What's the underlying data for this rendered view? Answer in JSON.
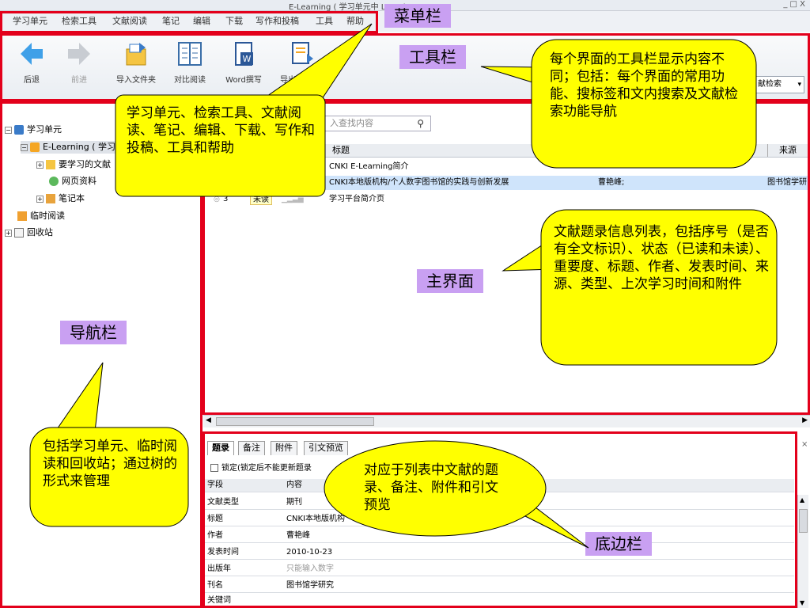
{
  "window": {
    "title": "E-Learning ( 学习单元中 Learning",
    "controls": "_  □  X"
  },
  "menu": [
    "学习单元",
    "检索工具",
    "文献阅读",
    "笔记",
    "编辑",
    "下载",
    "写作和投稿",
    "工具",
    "帮助"
  ],
  "toolbar": {
    "back": "后退",
    "forward": "前进",
    "import_folder": "导入文件夹",
    "compare_read": "对比阅读",
    "word_write": "Word撰写",
    "export_word": "导出到Word",
    "search_combo": "献检索"
  },
  "nav": {
    "root": "学习单元",
    "elearning": "E-Learning ( 学习",
    "to_learn": "要学习的文献",
    "web": "网页资料",
    "notebook": "笔记本",
    "temp_read": "临时阅读",
    "recycle": "回收站"
  },
  "main": {
    "search_placeholder": "入查找内容",
    "columns": {
      "title": "标题",
      "source": "来源"
    },
    "rows": [
      {
        "title": "CNKI E-Learning简介",
        "author": "",
        "source": ""
      },
      {
        "title": "CNKI本地版机构/个人数字图书馆的实践与创新发展",
        "author": "曹艳峰;",
        "source": "图书馆学研"
      },
      {
        "num": "3",
        "status": "未读",
        "title": "学习平台简介页",
        "author": "",
        "source": ""
      }
    ]
  },
  "bottom": {
    "tabs": [
      "题录",
      "备注",
      "附件",
      "引文预览"
    ],
    "lock_label": "锁定(锁定后不能更新题录",
    "col_field": "字段",
    "col_content": "内容",
    "props": [
      {
        "key": "文献类型",
        "val": "期刊"
      },
      {
        "key": "标题",
        "val": "CNKI本地版机构"
      },
      {
        "key": "作者",
        "val": "曹艳峰"
      },
      {
        "key": "发表时间",
        "val": "2010-10-23"
      },
      {
        "key": "出版年",
        "val": "只能输入数字"
      },
      {
        "key": "刊名",
        "val": "图书馆学研究"
      },
      {
        "key": "关键词",
        "val": ""
      }
    ]
  },
  "annotations": {
    "menubar": "菜单栏",
    "toolbar": "工具栏",
    "navbar": "导航栏",
    "mainui": "主界面",
    "bottombar": "底边栏",
    "menu_desc": "学习单元、检索工具、文献阅读、笔记、编辑、下载、写作和投稿、工具和帮助",
    "toolbar_desc": "每个界面的工具栏显示内容不同；包括：每个界面的常用功能、搜标签和文内搜索及文献检索功能导航",
    "list_desc": "文献题录信息列表，包括序号（是否有全文标识）、状态（已读和未读）、重要度、标题、作者、发表时间、来源、类型、上次学习时间和附件",
    "nav_desc": "包括学习单元、临时阅读和回收站；通过树的形式来管理",
    "bottom_desc": "对应于列表中文献的题录、备注、附件和引文预览"
  },
  "colors": {
    "annotation_red": "#e3001b",
    "callout_yellow": "#ffff00",
    "label_purple": "#c9a0f2"
  }
}
